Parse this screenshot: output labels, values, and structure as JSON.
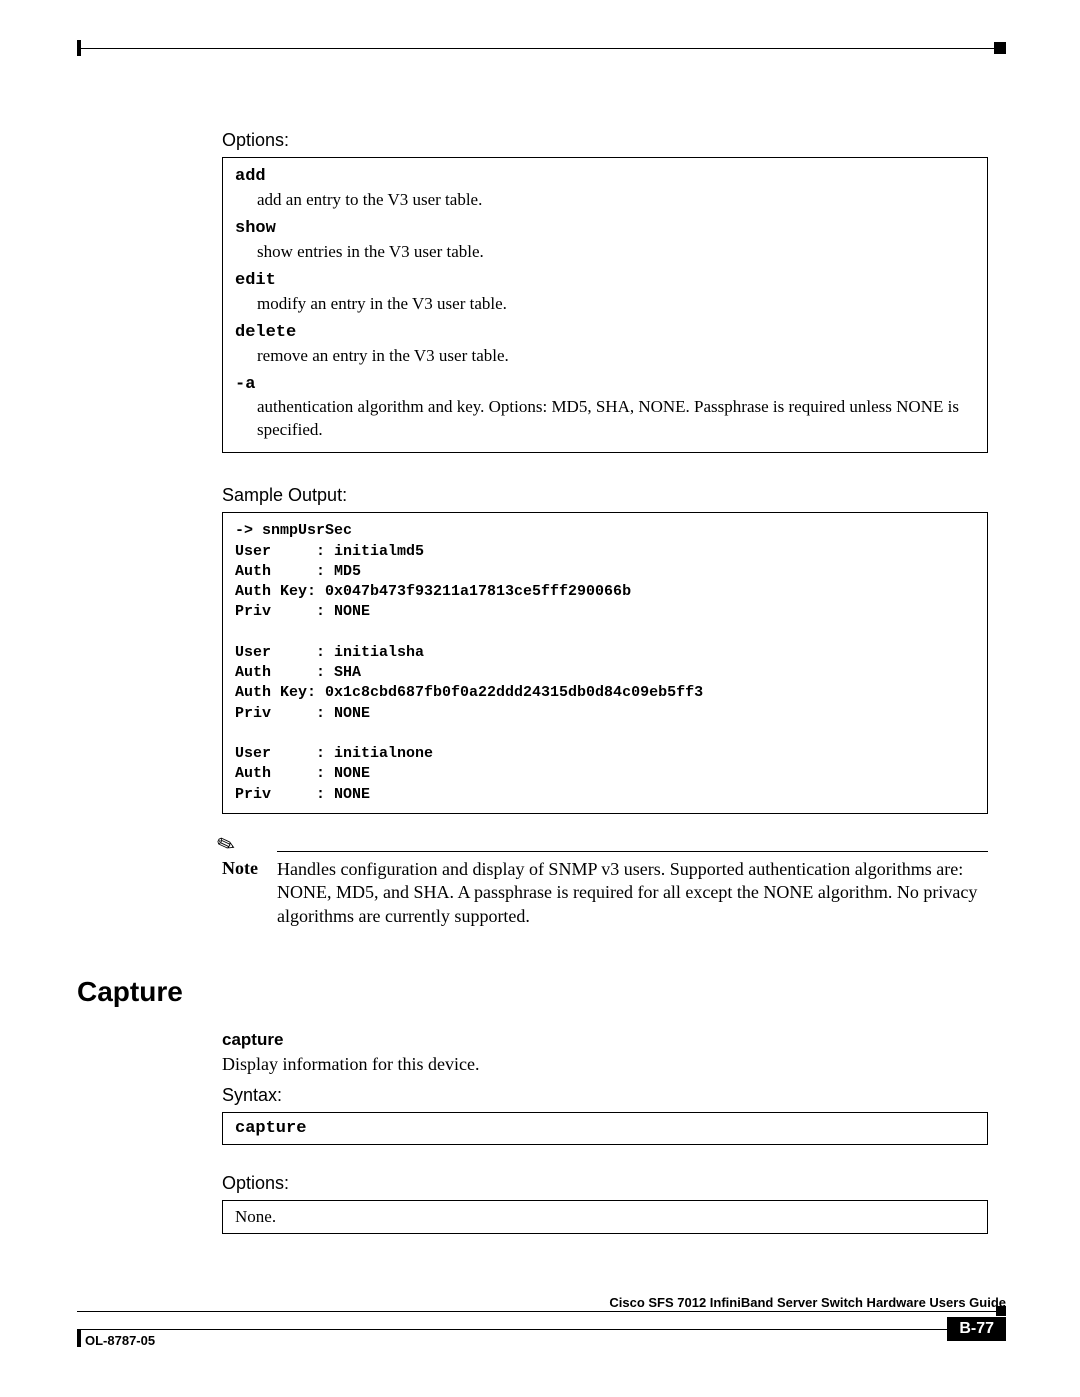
{
  "labels": {
    "options": "Options:",
    "sample_output": "Sample Output:",
    "syntax": "Syntax:"
  },
  "options_box": {
    "items": [
      {
        "term": "add",
        "desc": "add an entry to the V3 user table."
      },
      {
        "term": "show",
        "desc": "show entries in the V3 user table."
      },
      {
        "term": "edit",
        "desc": "modify an entry in the V3 user table."
      },
      {
        "term": "delete",
        "desc": "remove an entry in the V3 user table."
      },
      {
        "term": "-a",
        "desc": "authentication algorithm and key. Options: MD5, SHA, NONE. Passphrase is required unless NONE is specified."
      }
    ]
  },
  "sample_output": "-> snmpUsrSec\nUser     : initialmd5\nAuth     : MD5\nAuth Key: 0x047b473f93211a17813ce5fff290066b\nPriv     : NONE\n\nUser     : initialsha\nAuth     : SHA\nAuth Key: 0x1c8cbd687fb0f0a22ddd24315db0d84c09eb5ff3\nPriv     : NONE\n\nUser     : initialnone\nAuth     : NONE\nPriv     : NONE",
  "note": {
    "label": "Note",
    "text": "Handles configuration and display of SNMP v3 users.  Supported authentication algorithms are: NONE, MD5, and SHA.  A passphrase is required for all except the NONE algorithm.  No privacy algorithms are currently supported."
  },
  "section": {
    "heading": "Capture",
    "command_heading": "capture",
    "description": "Display information for this device.",
    "syntax_content": "capture",
    "options_content": "None."
  },
  "footer": {
    "book_title": "Cisco SFS 7012 InfiniBand Server Switch Hardware Users Guide",
    "doc_id": "OL-8787-05",
    "page": "B-77"
  }
}
